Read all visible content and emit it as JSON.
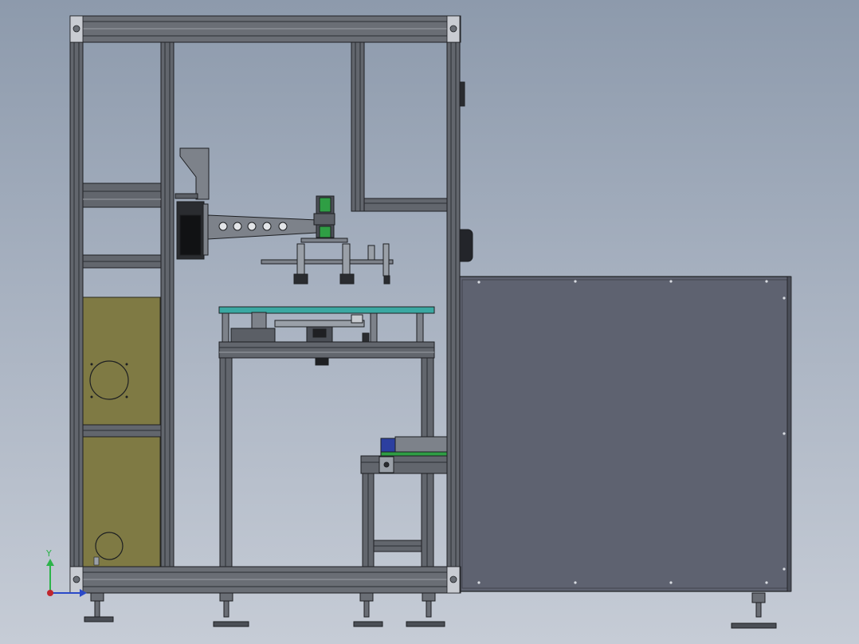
{
  "viewport": {
    "background_top": "#8d9aac",
    "background_bottom": "#c6ccd6"
  },
  "colors": {
    "profile": "#5b5f66",
    "profile_light": "#7d828a",
    "outline": "#1d1f22",
    "side_panel": "#5e6270",
    "yellow_panel": "#7f7a44",
    "table_top": "#3aa8a2",
    "green_part": "#2f9e44",
    "blue_part": "#2c3fa0",
    "axis_y": "#2cb34a",
    "axis_x": "#c0262d",
    "axis_z": "#2a49c8"
  },
  "triad": {
    "y_label": "Y"
  }
}
